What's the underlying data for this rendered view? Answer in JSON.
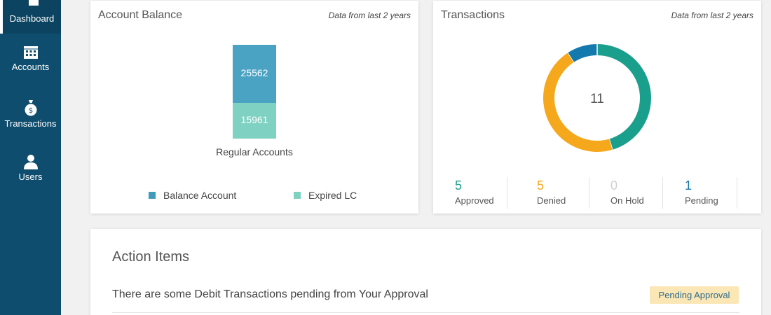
{
  "sidebar": {
    "items": [
      {
        "label": "Dashboard",
        "icon": "home-icon",
        "active": true
      },
      {
        "label": "Accounts",
        "icon": "calendar-icon"
      },
      {
        "label": "Transactions",
        "icon": "money-bag-icon"
      },
      {
        "label": "Users",
        "icon": "user-icon"
      }
    ],
    "background": "#0e4d6d"
  },
  "balance": {
    "title": "Account Balance",
    "note": "Data from last 2 years"
  },
  "transactions": {
    "title": "Transactions",
    "note": "Data from last 2 years",
    "total": "11",
    "stats": [
      {
        "value": "5",
        "label": "Approved",
        "color": "#1a9f8c"
      },
      {
        "value": "5",
        "label": "Denied",
        "color": "#f5a81c"
      },
      {
        "value": "0",
        "label": "On Hold",
        "color": "#cccccc"
      },
      {
        "value": "1",
        "label": "Pending",
        "color": "#1479ad"
      }
    ]
  },
  "action": {
    "title": "Action Items",
    "rows": [
      {
        "text": "There are some Debit Transactions pending from Your Approval",
        "badge": "Pending Approval"
      }
    ]
  },
  "chart_data": [
    {
      "type": "bar",
      "stacked": true,
      "categories": [
        "Regular Accounts"
      ],
      "series": [
        {
          "name": "Balance Account",
          "values": [
            25562
          ],
          "color": "#4ba3c3"
        },
        {
          "name": "Expired LC",
          "values": [
            15961
          ],
          "color": "#7fd1c1"
        }
      ],
      "legend": "bottom"
    },
    {
      "type": "pie",
      "donut": true,
      "center_label": "11",
      "slices": [
        {
          "label": "Approved",
          "value": 5,
          "color": "#1a9f8c"
        },
        {
          "label": "Denied",
          "value": 5,
          "color": "#f5a81c"
        },
        {
          "label": "On Hold",
          "value": 0,
          "color": "#cccccc"
        },
        {
          "label": "Pending",
          "value": 1,
          "color": "#1479ad"
        }
      ]
    }
  ]
}
